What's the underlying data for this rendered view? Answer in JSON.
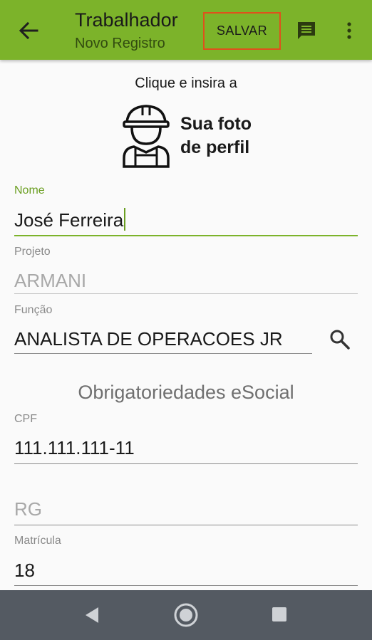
{
  "appbar": {
    "title": "Trabalhador",
    "subtitle": "Novo Registro",
    "save_label": "SALVAR",
    "back_icon": "arrow-back-icon",
    "chat_icon": "chat-icon",
    "more_icon": "more-vert-icon",
    "color": "#7cb32a"
  },
  "profile": {
    "hint": "Clique e insira a",
    "photo_label_line1": "Sua foto",
    "photo_label_line2": "de perfil",
    "icon": "worker-helmet-icon"
  },
  "form": {
    "nome": {
      "label": "Nome",
      "value": "José Ferreira"
    },
    "projeto": {
      "label": "Projeto",
      "value": "ARMANI"
    },
    "funcao": {
      "label": "Função",
      "value": "ANALISTA DE OPERACOES JR",
      "icon": "search-icon"
    },
    "section_title": "Obrigatoriedades eSocial",
    "cpf": {
      "label": "CPF",
      "value": "111.111.111-11"
    },
    "rg": {
      "placeholder": "RG"
    },
    "matricula": {
      "label": "Matrícula",
      "value": "18"
    }
  },
  "navbar": {
    "back_icon": "nav-back-icon",
    "home_icon": "nav-home-icon",
    "recent_icon": "nav-recents-icon"
  }
}
